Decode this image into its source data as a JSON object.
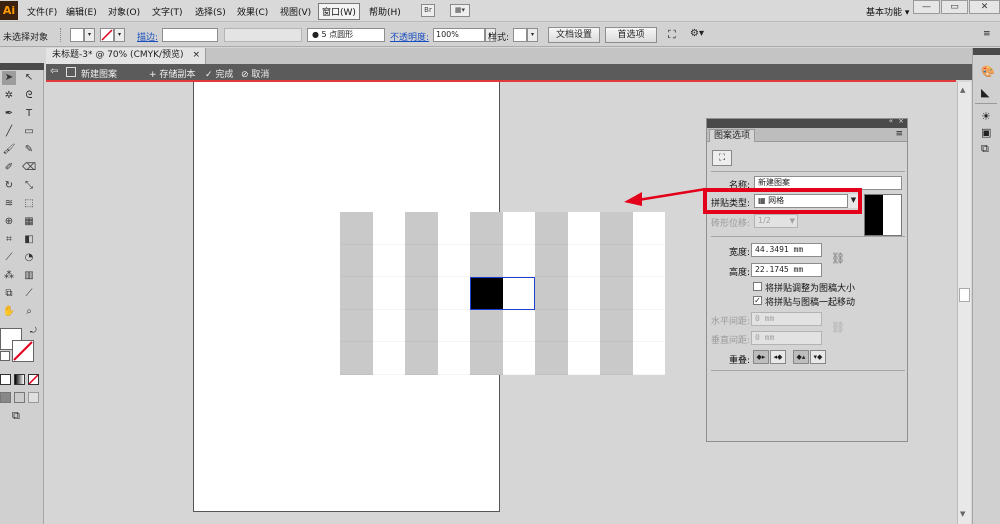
{
  "menubar": {
    "logo": "Ai",
    "items": [
      "文件(F)",
      "编辑(E)",
      "对象(O)",
      "文字(T)",
      "选择(S)",
      "效果(C)",
      "视图(V)",
      "窗口(W)",
      "帮助(H)"
    ],
    "bridge_label": "Br",
    "workspace_label": "基本功能",
    "workspace_arrow": "▾",
    "minimize": "—",
    "restore": "▭",
    "close": "✕"
  },
  "controlbar": {
    "selection_status": "未选择对象",
    "stroke_label": "描边:",
    "brush_value": "5 点圆形",
    "opacity_label": "不透明度:",
    "opacity_value": "100%",
    "style_label": "样式:",
    "doc_setup_button": "文档设置",
    "preferences_button": "首选项"
  },
  "document_tab": {
    "title": "未标题-3* @ 70% (CMYK/预览)",
    "close": "×"
  },
  "isolation_bar": {
    "mode_label": "新建图案",
    "save_copy": "+ 存储副本",
    "done": "✓ 完成",
    "cancel": "⊘ 取消"
  },
  "pattern_panel": {
    "title": "图案选项",
    "name_label": "名称:",
    "name_value": "新建图案",
    "tile_type_label": "拼贴类型:",
    "tile_type_value": "网格",
    "brick_offset_label": "砖形位移:",
    "brick_offset_value": "1/2",
    "width_label": "宽度:",
    "width_value": "44.3491 mm",
    "height_label": "高度:",
    "height_value": "22.1745 mm",
    "fit_art_label": "将拼贴调整为图稿大小",
    "fit_art_checked": false,
    "move_with_art_label": "将拼贴与图稿一起移动",
    "move_with_art_checked": true,
    "h_spacing_label": "水平间距:",
    "h_spacing_value": "0 mm",
    "v_spacing_label": "垂直间距:",
    "v_spacing_value": "0 mm",
    "overlap_label": "重叠:"
  },
  "colors": {
    "highlight": "#e3001b",
    "accent_blue": "#1a4fbf",
    "isolation_bar": "#5b5b5b"
  },
  "pattern_preview": {
    "columns": 10,
    "rows": 5,
    "dark_columns": [
      0,
      2,
      4,
      6,
      8
    ],
    "selected_tile": {
      "col": 4,
      "row": 2
    }
  }
}
